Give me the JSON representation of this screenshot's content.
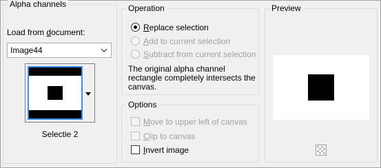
{
  "alpha_channels": {
    "title": "Alpha channels",
    "load_label_pre": "Load from ",
    "load_label_u": "d",
    "load_label_post": "ocument:",
    "document_value": "Image44",
    "selection_caption": "Selectie 2"
  },
  "operation": {
    "title": "Operation",
    "options": [
      {
        "u": "R",
        "rest": "eplace selection",
        "selected": true,
        "enabled": true
      },
      {
        "u": "A",
        "rest": "dd to current selection",
        "selected": false,
        "enabled": false
      },
      {
        "u": "S",
        "rest": "ubtract from current selection",
        "selected": false,
        "enabled": false
      }
    ],
    "description": "The original alpha channel rectangle completely intersects the canvas."
  },
  "options": {
    "title": "Options",
    "items": [
      {
        "u": "M",
        "rest": "ove to upper left of canvas",
        "checked": false,
        "enabled": false
      },
      {
        "u": "C",
        "rest": "lip to canvas",
        "checked": false,
        "enabled": false
      },
      {
        "u": "I",
        "rest": "nvert image",
        "checked": false,
        "enabled": true
      }
    ]
  },
  "preview": {
    "title": "Preview"
  },
  "icons": {
    "dropdown": "chevron-down-icon",
    "preview_toggle": "checkerboard-icon"
  }
}
